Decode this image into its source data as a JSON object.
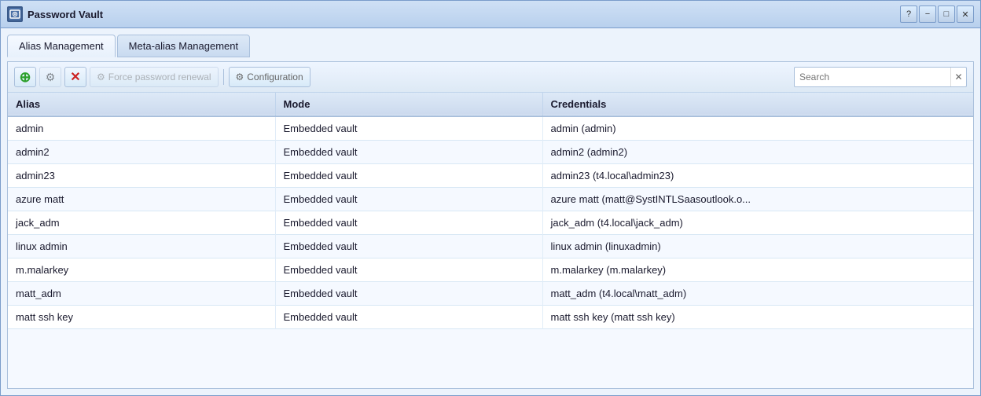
{
  "window": {
    "title": "Password Vault",
    "icon": "vault-icon",
    "controls": {
      "help": "?",
      "minimize": "−",
      "maximize": "□",
      "close": "✕"
    }
  },
  "tabs": [
    {
      "id": "alias",
      "label": "Alias Management",
      "active": true
    },
    {
      "id": "meta-alias",
      "label": "Meta-alias Management",
      "active": false
    }
  ],
  "toolbar": {
    "add_label": "+",
    "edit_label": "⚙",
    "delete_label": "✕",
    "force_renewal_label": "Force password renewal",
    "configuration_label": "Configuration",
    "search_placeholder": "Search",
    "search_clear": "✕"
  },
  "table": {
    "headers": [
      "Alias",
      "Mode",
      "Credentials"
    ],
    "rows": [
      {
        "alias": "admin",
        "mode": "Embedded vault",
        "credentials": "admin (admin)"
      },
      {
        "alias": "admin2",
        "mode": "Embedded vault",
        "credentials": "admin2 (admin2)"
      },
      {
        "alias": "admin23",
        "mode": "Embedded vault",
        "credentials": "admin23 (t4.local\\admin23)"
      },
      {
        "alias": "azure matt",
        "mode": "Embedded vault",
        "credentials": "azure matt (matt@SystINTLSaasoutlook.o..."
      },
      {
        "alias": "jack_adm",
        "mode": "Embedded vault",
        "credentials": "jack_adm (t4.local\\jack_adm)"
      },
      {
        "alias": "linux admin",
        "mode": "Embedded vault",
        "credentials": "linux admin (linuxadmin)"
      },
      {
        "alias": "m.malarkey",
        "mode": "Embedded vault",
        "credentials": "m.malarkey (m.malarkey)"
      },
      {
        "alias": "matt_adm",
        "mode": "Embedded vault",
        "credentials": "matt_adm (t4.local\\matt_adm)"
      },
      {
        "alias": "matt ssh key",
        "mode": "Embedded vault",
        "credentials": "matt ssh key (matt ssh key)"
      }
    ]
  },
  "colors": {
    "accent": "#4a90d9",
    "add_green": "#2ca02c",
    "delete_red": "#cc2222",
    "header_bg": "#d4e3f5"
  }
}
